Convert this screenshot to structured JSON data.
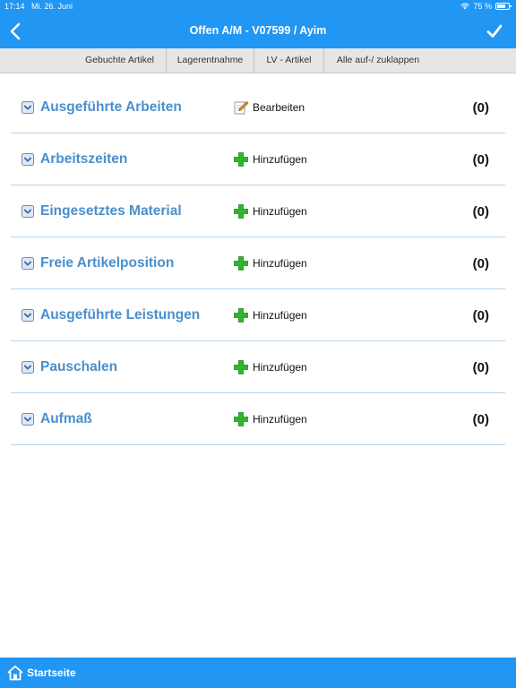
{
  "status_bar": {
    "time": "17:14",
    "date": "Mi. 26. Juni",
    "battery": "75 %",
    "battery_level": 0.75
  },
  "nav": {
    "title": "Offen A/M - V07599 / Ayim",
    "back_icon": "chevron-left-icon",
    "done_icon": "checkmark-icon"
  },
  "toolbar": {
    "items": [
      "Gebuchte Artikel",
      "Lagerentnahme",
      "LV - Artikel",
      "Alle auf-/ zuklappen"
    ]
  },
  "sections": [
    {
      "title": "Ausgeführte Arbeiten",
      "action": "Bearbeiten",
      "action_icon": "edit-icon",
      "count": "(0)"
    },
    {
      "title": "Arbeitszeiten",
      "action": "Hinzufügen",
      "action_icon": "plus-icon",
      "count": "(0)"
    },
    {
      "title": "Eingesetztes Material",
      "action": "Hinzufügen",
      "action_icon": "plus-icon",
      "count": "(0)"
    },
    {
      "title": "Freie Artikelposition",
      "action": "Hinzufügen",
      "action_icon": "plus-icon",
      "count": "(0)"
    },
    {
      "title": "Ausgeführte Leistungen",
      "action": "Hinzufügen",
      "action_icon": "plus-icon",
      "count": "(0)"
    },
    {
      "title": "Pauschalen",
      "action": "Hinzufügen",
      "action_icon": "plus-icon",
      "count": "(0)"
    },
    {
      "title": "Aufmaß",
      "action": "Hinzufügen",
      "action_icon": "plus-icon",
      "count": "(0)"
    }
  ],
  "footer": {
    "home_label": "Startseite",
    "home_icon": "home-icon"
  },
  "colors": {
    "accent": "#2196f3",
    "section_title": "#4a8fcc",
    "divider": "#b9d4ec",
    "toolbar_bg": "#e6e6e6",
    "add_green": "#2fb52f"
  }
}
